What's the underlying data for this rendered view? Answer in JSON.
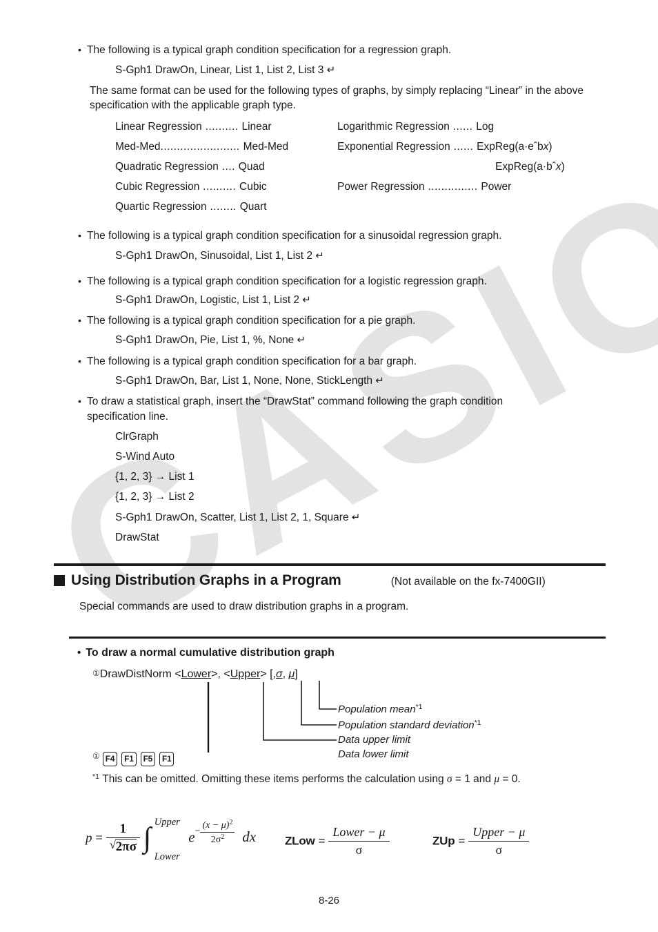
{
  "watermark": {
    "text": "CASIO"
  },
  "intro": {
    "bullet1": "The following is a typical graph condition specification for a regression graph.",
    "code1": "S-Gph1 DrawOn, Linear, List 1, List 2, List 3",
    "paragraph": "The same format can be used for the following types of graphs, by simply replacing “Linear” in the above specification with the applicable graph type."
  },
  "regression_table": {
    "rows": [
      {
        "left_name": "Linear Regression",
        "left_dots": " .......... ",
        "left_value": "Linear",
        "right_name": "Logarithmic Regression",
        "right_dots": " ...... ",
        "right_value": "Log"
      },
      {
        "left_name": "Med-Med",
        "left_dots": "........................ ",
        "left_value": "Med-Med",
        "right_name": "Exponential Regression",
        "right_dots": " ...... ",
        "right_value": "ExpReg(a·eˆb"
      },
      {
        "left_name": "Quadratic Regression",
        "left_dots": " .... ",
        "left_value": "Quad",
        "right_name": "",
        "right_dots": "",
        "right_value": "ExpReg(a·bˆ"
      },
      {
        "left_name": "Cubic Regression",
        "left_dots": " .......... ",
        "left_value": "Cubic",
        "right_name": "Power Regression",
        "right_dots": " ............... ",
        "right_value": "Power"
      },
      {
        "left_name": "Quartic Regression",
        "left_dots": " ........ ",
        "left_value": "Quart",
        "right_name": "",
        "right_dots": "",
        "right_value": ""
      }
    ],
    "italic_x": "x",
    "close_paren": ")"
  },
  "specs": [
    {
      "bullet": "The following is a typical graph condition specification for a sinusoidal regression graph.",
      "code": "S-Gph1 DrawOn, Sinusoidal, List 1, List 2"
    },
    {
      "bullet": "The following is a typical graph condition specification for a logistic regression graph.",
      "code": "S-Gph1 DrawOn, Logistic, List 1, List 2"
    },
    {
      "bullet": "The following is a typical graph condition specification for a pie graph.",
      "code": "S-Gph1 DrawOn, Pie, List 1, %, None"
    },
    {
      "bullet": "The following is a typical graph condition specification for a bar graph.",
      "code": "S-Gph1 DrawOn, Bar, List 1, None, None, StickLength"
    }
  ],
  "drawstat": {
    "bullet_line1": "To draw a statistical graph, insert the “DrawStat” command following the graph condition",
    "bullet_line2": "specification line.",
    "lines": [
      "ClrGraph",
      "S-Wind Auto",
      "{1, 2, 3} → List 1",
      "{1, 2, 3} → List 2",
      "S-Gph1 DrawOn, Scatter, List 1, List 2, 1, Square",
      "DrawStat"
    ],
    "return_on_line_index": 4
  },
  "section": {
    "marker": "square-marker",
    "title": "Using Distribution Graphs in a Program",
    "note": "(Not available on the fx-7400GII)",
    "subtitle": "Special commands are used to draw distribution graphs in a program."
  },
  "subsection": {
    "bullet": "•",
    "title": "To draw a normal cumulative distribution graph"
  },
  "syntax": {
    "marker": "①",
    "command": "DrawDistNorm",
    "arg_lower": "Lower",
    "arg_upper": "Upper",
    "optional_sigma": "σ",
    "optional_mu": "μ",
    "full_text": "DrawDistNorm <Lower>, <Upper> [,σ, μ]"
  },
  "callouts": [
    {
      "label": "Population mean",
      "note": "*1"
    },
    {
      "label": "Population standard deviation",
      "note": "*1"
    },
    {
      "label": "Data upper limit",
      "note": ""
    },
    {
      "label": "Data lower limit",
      "note": ""
    }
  ],
  "fkeys": {
    "marker": "①",
    "keys": [
      "F4",
      "F1",
      "F5",
      "F1"
    ]
  },
  "footnote": {
    "marker": "*1",
    "text_a": "This can be omitted. Omitting these items performs the calculation using ",
    "sigma": "σ",
    "text_b": " = 1 and ",
    "mu": "μ",
    "text_c": " = 0."
  },
  "formula_p": {
    "lhs": "p",
    "eq": "=",
    "frac_num": "1",
    "frac_den_inner": "2πσ",
    "int_upper": "Upper",
    "int_lower": "Lower",
    "base": "e",
    "exp_minus": "−",
    "exp_num": "(x − μ)",
    "exp_num_sup": "2",
    "exp_den": "2σ",
    "exp_den_sup": "2",
    "dx": "dx"
  },
  "formula_zlow": {
    "label": "ZLow",
    "eq": "=",
    "num": "Lower − μ",
    "den": "σ"
  },
  "formula_zup": {
    "label": "ZUp",
    "eq": "=",
    "num": "Upper − μ",
    "den": "σ"
  },
  "footer": {
    "page": "8-26"
  }
}
